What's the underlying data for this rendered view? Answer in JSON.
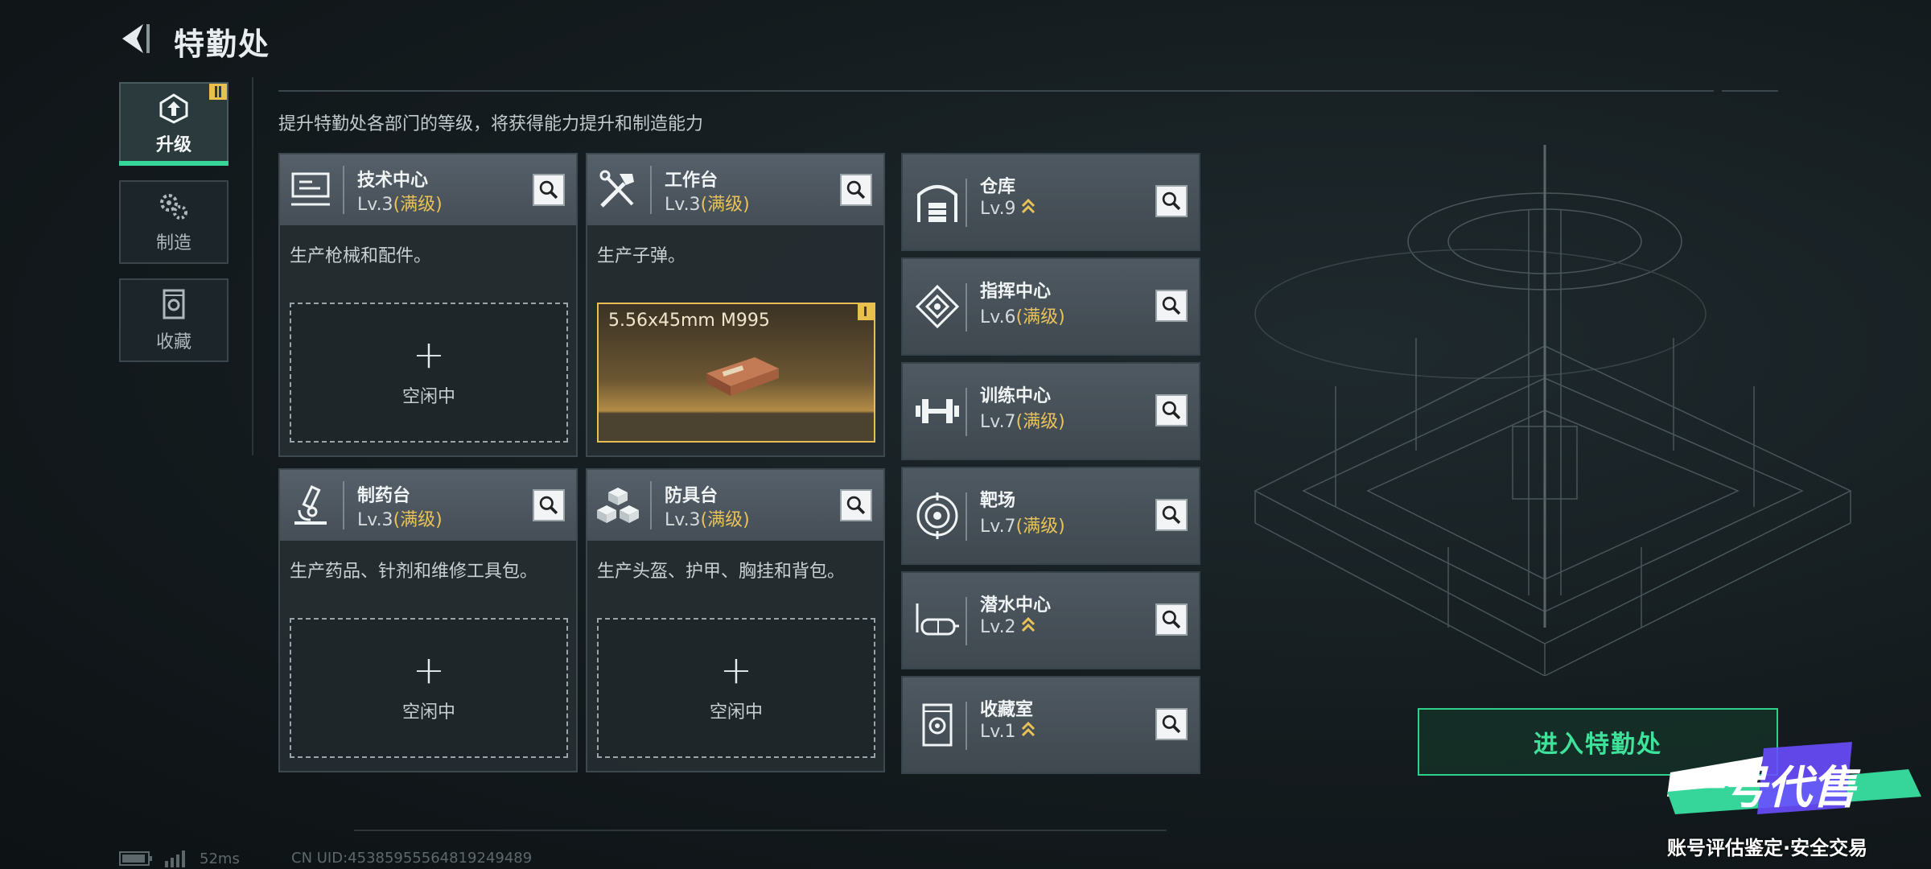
{
  "header": {
    "title": "特勤处"
  },
  "subtitle": "提升特勤处各部门的等级，将获得能力提升和制造能力",
  "side_tabs": [
    {
      "label": "升级",
      "icon": "upgrade-icon",
      "active": true
    },
    {
      "label": "制造",
      "icon": "gears-icon",
      "active": false
    },
    {
      "label": "收藏",
      "icon": "collection-icon",
      "active": false
    }
  ],
  "facilities": [
    {
      "name": "技术中心",
      "level": "Lv.3",
      "max": "(满级)",
      "desc": "生产枪械和配件。",
      "slot": {
        "plus": "+",
        "status": "空闲中"
      }
    },
    {
      "name": "工作台",
      "level": "Lv.3",
      "max": "(满级)",
      "desc": "生产子弹。",
      "product": "5.56x45mm M995"
    },
    {
      "name": "制药台",
      "level": "Lv.3",
      "max": "(满级)",
      "desc": "生产药品、针剂和维修工具包。",
      "slot": {
        "plus": "+",
        "status": "空闲中"
      }
    },
    {
      "name": "防具台",
      "level": "Lv.3",
      "max": "(满级)",
      "desc": "生产头盔、护甲、胸挂和背包。",
      "slot": {
        "plus": "+",
        "status": "空闲中"
      }
    }
  ],
  "departments": [
    {
      "name": "仓库",
      "level": "Lv.9",
      "max": "",
      "upgradable": true
    },
    {
      "name": "指挥中心",
      "level": "Lv.6",
      "max": "(满级)",
      "upgradable": false
    },
    {
      "name": "训练中心",
      "level": "Lv.7",
      "max": "(满级)",
      "upgradable": false
    },
    {
      "name": "靶场",
      "level": "Lv.7",
      "max": "(满级)",
      "upgradable": false
    },
    {
      "name": "潜水中心",
      "level": "Lv.2",
      "max": "",
      "upgradable": true
    },
    {
      "name": "收藏室",
      "level": "Lv.1",
      "max": "",
      "upgradable": true
    }
  ],
  "enter_button": "进入特勤处",
  "footer": {
    "ping": "52ms",
    "uid": "CN UID:4538595556481924948​9"
  },
  "watermark": {
    "logo": "一号代售",
    "tagline": "账号评估鉴定·安全交易"
  },
  "colors": {
    "accent_green": "#36d59a",
    "max_gold": "#e9c25a"
  }
}
